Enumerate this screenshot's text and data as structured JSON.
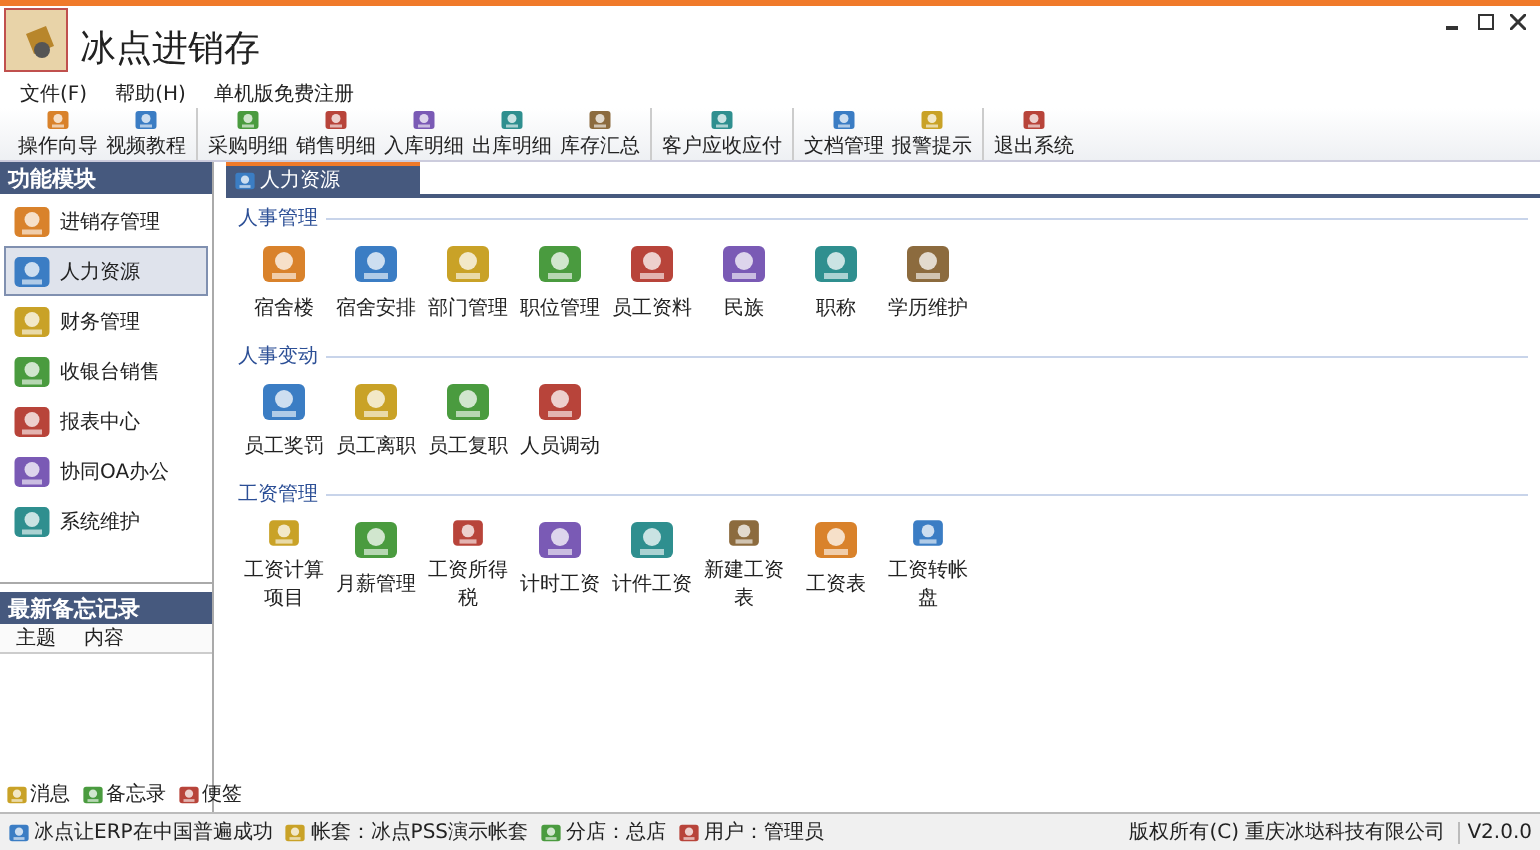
{
  "window": {
    "title": "冰点进销存"
  },
  "menu": [
    "文件(F)",
    "帮助(H)",
    "单机版免费注册"
  ],
  "toolbar": {
    "groups": [
      {
        "items": [
          "操作向导",
          "视频教程"
        ]
      },
      {
        "items": [
          "采购明细",
          "销售明细",
          "入库明细",
          "出库明细",
          "库存汇总"
        ]
      },
      {
        "items": [
          "客户应收应付"
        ]
      },
      {
        "items": [
          "文档管理",
          "报警提示"
        ]
      },
      {
        "items": [
          "退出系统"
        ]
      }
    ]
  },
  "sidebar": {
    "title": "功能模块",
    "items": [
      {
        "label": "进销存管理",
        "selected": false
      },
      {
        "label": "人力资源",
        "selected": true
      },
      {
        "label": "财务管理",
        "selected": false
      },
      {
        "label": "收银台销售",
        "selected": false
      },
      {
        "label": "报表中心",
        "selected": false
      },
      {
        "label": "协同OA办公",
        "selected": false
      },
      {
        "label": "系统维护",
        "selected": false
      }
    ]
  },
  "memo": {
    "title": "最新备忘记录",
    "columns": [
      "主题",
      "内容"
    ],
    "links": [
      "消息",
      "备忘录",
      "便签"
    ]
  },
  "tabs": [
    {
      "label": "人力资源",
      "selected": true
    }
  ],
  "sections": [
    {
      "title": "人事管理",
      "items": [
        "宿舍楼",
        "宿舍安排",
        "部门管理",
        "职位管理",
        "员工资料",
        "民族",
        "职称",
        "学历维护"
      ]
    },
    {
      "title": "人事变动",
      "items": [
        "员工奖罚",
        "员工离职",
        "员工复职",
        "人员调动"
      ]
    },
    {
      "title": "工资管理",
      "items": [
        "工资计算项目",
        "月薪管理",
        "工资所得税",
        "计时工资",
        "计件工资",
        "新建工资表",
        "工资表",
        "工资转帐盘"
      ]
    }
  ],
  "status_bar": {
    "items": [
      "冰点让ERP在中国普遍成功",
      "帐套：冰点PSS演示帐套",
      "分店：总店",
      "用户：管理员"
    ],
    "copyright": "版权所有(C) 重庆冰垯科技有限公司",
    "version": "V2.0.0"
  }
}
